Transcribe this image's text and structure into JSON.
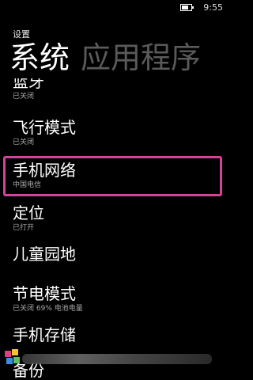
{
  "status_bar": {
    "time": "9:55",
    "battery_level": 0.7
  },
  "app_title": "设置",
  "pivot": {
    "current": "系统",
    "next": "应用程序"
  },
  "list_items": [
    {
      "title": "蓝牙",
      "subtitle": "已关闭"
    },
    {
      "title": "飞行模式",
      "subtitle": "已关闭"
    },
    {
      "title": "手机网络",
      "subtitle": "中国电信"
    },
    {
      "title": "定位",
      "subtitle": "已打开"
    },
    {
      "title": "儿童园地",
      "subtitle": ""
    },
    {
      "title": "节电模式",
      "subtitle": "已关闭 69% 电池电量"
    },
    {
      "title": "手机存储",
      "subtitle": ""
    },
    {
      "title": "备份",
      "subtitle": ""
    }
  ],
  "colors": {
    "highlight": "#d0449b",
    "background": "#000000",
    "inactive_pivot": "#5a5a5a"
  },
  "icons": [
    "battery-icon",
    "watermark-logo"
  ]
}
